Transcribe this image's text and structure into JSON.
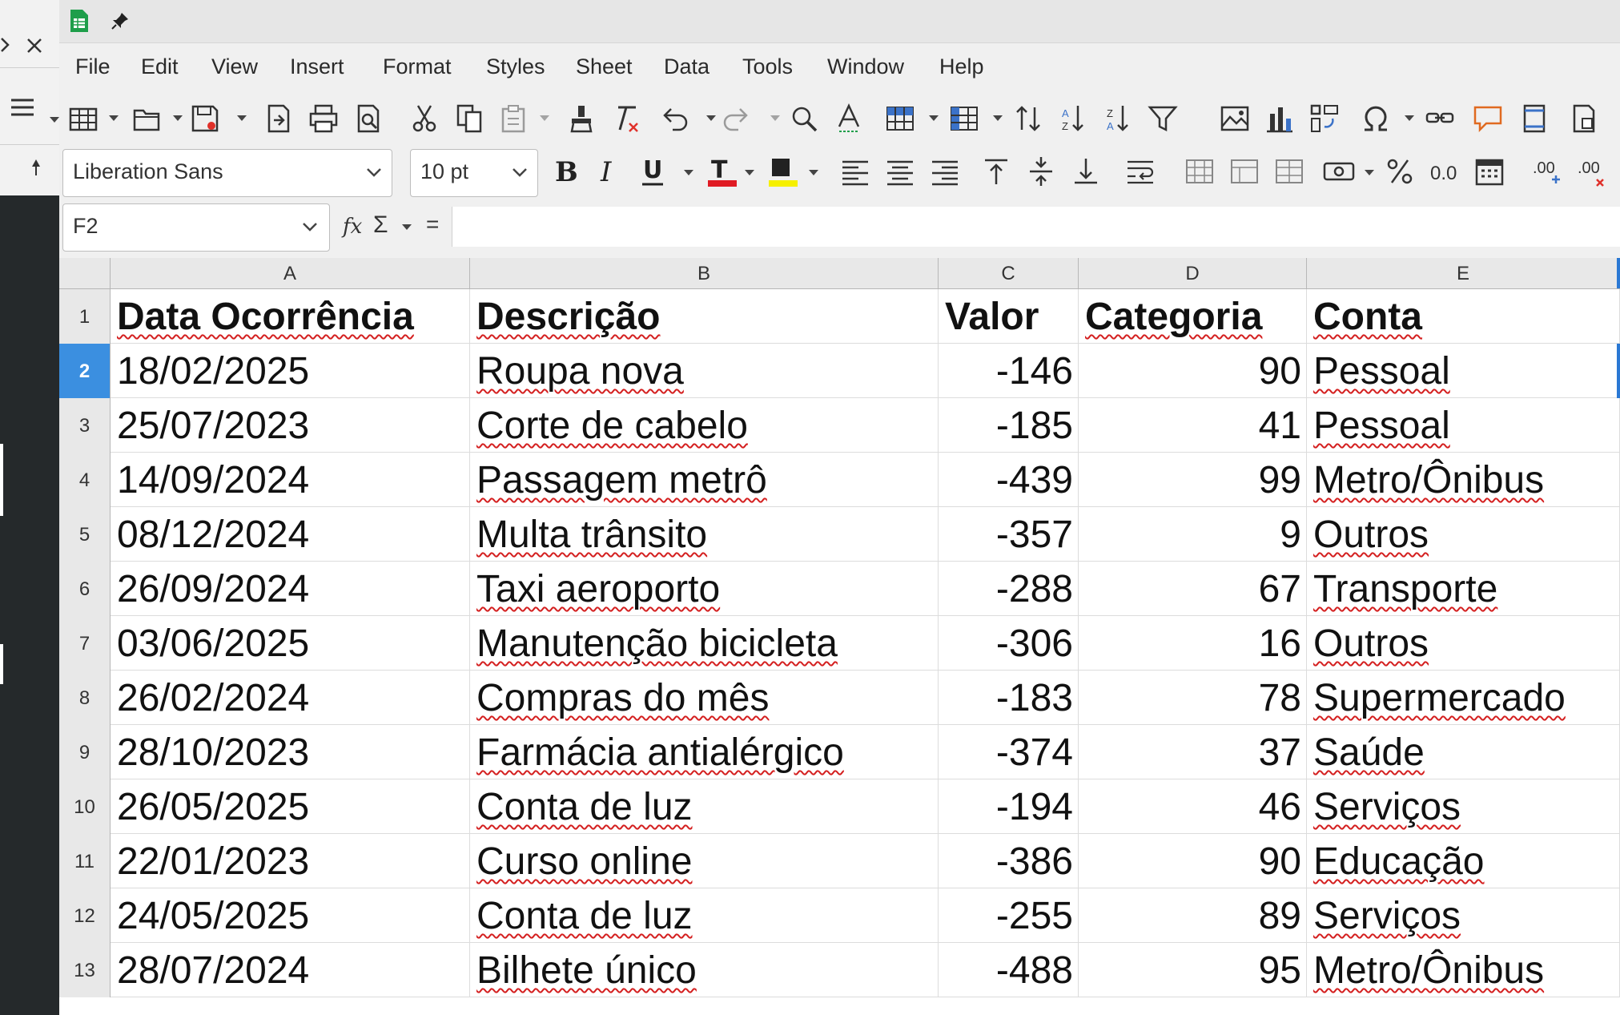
{
  "menu": [
    "File",
    "Edit",
    "View",
    "Insert",
    "Format",
    "Styles",
    "Sheet",
    "Data",
    "Tools",
    "Window",
    "Help"
  ],
  "font_name": "Liberation Sans",
  "font_size": "10 pt",
  "name_box": "F2",
  "formula_symbols": {
    "fx": "fx",
    "sum": "Σ",
    "equals": "="
  },
  "columns": [
    "A",
    "B",
    "C",
    "D",
    "E"
  ],
  "header_row": {
    "num": "1",
    "cells": [
      "Data Ocorrência",
      "Descrição",
      "Valor",
      "Categoria",
      "Conta"
    ]
  },
  "rows": [
    {
      "num": "2",
      "date": "18/02/2025",
      "desc": "Roupa nova",
      "valor": "-146",
      "cat": "90",
      "conta": "Pessoal"
    },
    {
      "num": "3",
      "date": "25/07/2023",
      "desc": "Corte de cabelo",
      "valor": "-185",
      "cat": "41",
      "conta": "Pessoal"
    },
    {
      "num": "4",
      "date": "14/09/2024",
      "desc": "Passagem metrô",
      "valor": "-439",
      "cat": "99",
      "conta": "Metro/Ônibus"
    },
    {
      "num": "5",
      "date": "08/12/2024",
      "desc": "Multa trânsito",
      "valor": "-357",
      "cat": "9",
      "conta": "Outros"
    },
    {
      "num": "6",
      "date": "26/09/2024",
      "desc": "Taxi aeroporto",
      "valor": "-288",
      "cat": "67",
      "conta": "Transporte"
    },
    {
      "num": "7",
      "date": "03/06/2025",
      "desc": "Manutenção bicicleta",
      "valor": "-306",
      "cat": "16",
      "conta": "Outros"
    },
    {
      "num": "8",
      "date": "26/02/2024",
      "desc": "Compras do mês",
      "valor": "-183",
      "cat": "78",
      "conta": "Supermercado"
    },
    {
      "num": "9",
      "date": "28/10/2023",
      "desc": "Farmácia antialérgico",
      "valor": "-374",
      "cat": "37",
      "conta": "Saúde"
    },
    {
      "num": "10",
      "date": "26/05/2025",
      "desc": "Conta de luz",
      "valor": "-194",
      "cat": "46",
      "conta": "Serviços"
    },
    {
      "num": "11",
      "date": "22/01/2023",
      "desc": "Curso online",
      "valor": "-386",
      "cat": "90",
      "conta": "Educação"
    },
    {
      "num": "12",
      "date": "24/05/2025",
      "desc": "Conta de luz",
      "valor": "-255",
      "cat": "89",
      "conta": "Serviços"
    },
    {
      "num": "13",
      "date": "28/07/2024",
      "desc": "Bilhete único",
      "valor": "-488",
      "cat": "95",
      "conta": "Metro/Ônibus"
    }
  ],
  "colors": {
    "selection": "#3b8fe0",
    "font_color_bar": "#e01b24",
    "highlight_bar": "#f6f000"
  },
  "icons": {
    "leftpane": [
      "chevron-right-icon",
      "close-icon",
      "hamburger-menu-icon",
      "pin-icon"
    ],
    "titlebar": [
      "calc-app-icon",
      "pin-icon"
    ],
    "toolbar1": [
      "table-icon",
      "open-folder-icon",
      "save-icon",
      "export-pdf-icon",
      "print-icon",
      "print-preview-icon",
      "cut-icon",
      "copy-icon",
      "paste-icon",
      "clone-formatting-icon",
      "clear-formatting-icon",
      "undo-icon",
      "redo-icon",
      "find-replace-icon",
      "spelling-icon",
      "row-icon",
      "column-icon",
      "sort-icon",
      "sort-ascending-icon",
      "sort-descending-icon",
      "autofilter-icon",
      "image-icon",
      "chart-icon",
      "pivot-table-icon",
      "special-character-icon",
      "hyperlink-icon",
      "comment-icon",
      "headers-footers-icon",
      "define-print-area-icon"
    ],
    "toolbar2": [
      "bold-icon",
      "italic-icon",
      "underline-icon",
      "font-color-icon",
      "highlight-icon",
      "align-left-icon",
      "align-center-icon",
      "align-right-icon",
      "align-top-icon",
      "align-middle-icon",
      "align-bottom-icon",
      "wrap-text-icon",
      "merge-cells-icon",
      "unmerge-icon",
      "split-icon",
      "currency-icon",
      "percent-icon",
      "number-icon",
      "date-icon",
      "add-decimal-icon",
      "delete-decimal-icon"
    ]
  }
}
